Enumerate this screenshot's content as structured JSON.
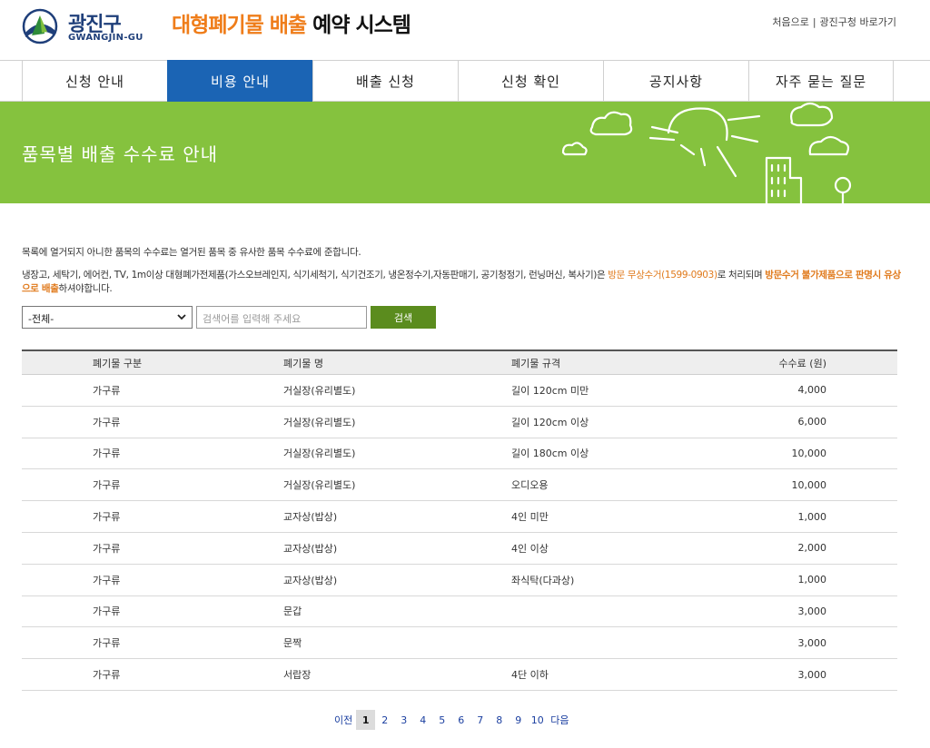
{
  "header": {
    "logo_ko": "광진구",
    "logo_en": "GWANGJIN-GU",
    "title_accent": "대형폐기물 배출",
    "title_rest": "예약 시스템",
    "links": [
      "처음으로",
      "광진구청 바로가기"
    ],
    "link_sep": "|"
  },
  "nav": {
    "items": [
      "신청 안내",
      "비용 안내",
      "배출 신청",
      "신청 확인",
      "공지사항",
      "자주 묻는 질문"
    ],
    "active_index": 1
  },
  "banner": {
    "title": "품목별 배출 수수료 안내",
    "color": "#85c23e"
  },
  "notice": {
    "line1": "목록에 열거되지 아니한 품목의 수수료는 열거된 품목 중 유사한 품목 수수료에 준합니다.",
    "line2_a": "냉장고, 세탁기, 에어컨, TV, 1m이상 대형폐가전제품(가스오브레인지, 식기세척기, 식기건조기, 냉온정수기,자동판매기, 공기청정기, 런닝머신, 복사기)은 ",
    "line2_hl1": "방문 무상수거(1599-0903)",
    "line2_b": "로 처리되며 ",
    "line2_hl2": "방문수거 불가제품으로 판명시 유상으로 배출",
    "line2_c": "하셔야합니다."
  },
  "search": {
    "select_value": "-전체-",
    "input_placeholder": "검색어를 입력해 주세요",
    "button_label": "검색"
  },
  "table": {
    "headers": [
      "폐기물 구분",
      "폐기물 명",
      "폐기물 규격",
      "수수료 (원)"
    ],
    "rows": [
      [
        "가구류",
        "거실장(유리별도)",
        "길이 120cm 미만",
        "4,000"
      ],
      [
        "가구류",
        "거실장(유리별도)",
        "길이 120cm 이상",
        "6,000"
      ],
      [
        "가구류",
        "거실장(유리별도)",
        "길이 180cm 이상",
        "10,000"
      ],
      [
        "가구류",
        "거실장(유리별도)",
        "오디오용",
        "10,000"
      ],
      [
        "가구류",
        "교자상(밥상)",
        "4인 미만",
        "1,000"
      ],
      [
        "가구류",
        "교자상(밥상)",
        "4인 이상",
        "2,000"
      ],
      [
        "가구류",
        "교자상(밥상)",
        "좌식탁(다과상)",
        "1,000"
      ],
      [
        "가구류",
        "문갑",
        "",
        "3,000"
      ],
      [
        "가구류",
        "문짝",
        "",
        "3,000"
      ],
      [
        "가구류",
        "서랍장",
        "4단 이하",
        "3,000"
      ]
    ]
  },
  "pagination": {
    "prev_label": "이전",
    "next_label": "다음",
    "pages": [
      "1",
      "2",
      "3",
      "4",
      "5",
      "6",
      "7",
      "8",
      "9",
      "10"
    ],
    "current": "1"
  }
}
